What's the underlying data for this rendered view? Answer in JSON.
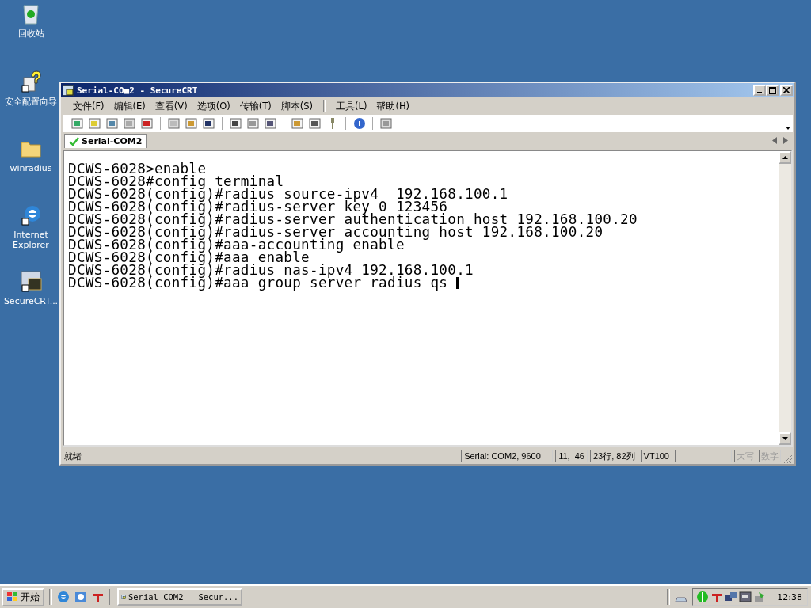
{
  "desktop_icons": [
    {
      "kind": "recycle",
      "label": "回收站"
    },
    {
      "kind": "wizard",
      "label": "安全配置向导"
    },
    {
      "kind": "folder",
      "label": "winradius"
    },
    {
      "kind": "ie",
      "label": "Internet Explorer"
    },
    {
      "kind": "crt",
      "label": "SecureCRT..."
    }
  ],
  "window": {
    "title": "Serial-CO■2 - SecureCRT",
    "menu": [
      "文件(F)",
      "编辑(E)",
      "查看(V)",
      "选项(O)",
      "传输(T)",
      "脚本(S)",
      "工具(L)",
      "帮助(H)"
    ],
    "tab": {
      "label": "Serial-COM2",
      "selected": true
    },
    "terminal": {
      "lines": [
        "DCWS-6028>enable",
        "DCWS-6028#config terminal",
        "DCWS-6028(config)#radius source-ipv4  192.168.100.1",
        "DCWS-6028(config)#radius-server key 0 123456",
        "DCWS-6028(config)#radius-server authentication host 192.168.100.20",
        "DCWS-6028(config)#radius-server accounting host 192.168.100.20",
        "DCWS-6028(config)#aaa-accounting enable",
        "DCWS-6028(config)#aaa enable",
        "DCWS-6028(config)#radius nas-ipv4 192.168.100.1",
        "DCWS-6028(config)#aaa group server radius qs "
      ]
    },
    "status_bar": {
      "text": "就绪",
      "panels": [
        "Serial: COM2, 9600",
        "11,  46",
        "23行, 82列",
        "VT100"
      ],
      "indicators": [
        {
          "label": "大写",
          "disabled": true
        },
        {
          "label": "数字",
          "disabled": true
        }
      ]
    }
  },
  "taskbar": {
    "start": "开始",
    "task": {
      "label": "Serial-COM2 - Secur...",
      "selected": false
    },
    "clock": "12:38"
  }
}
